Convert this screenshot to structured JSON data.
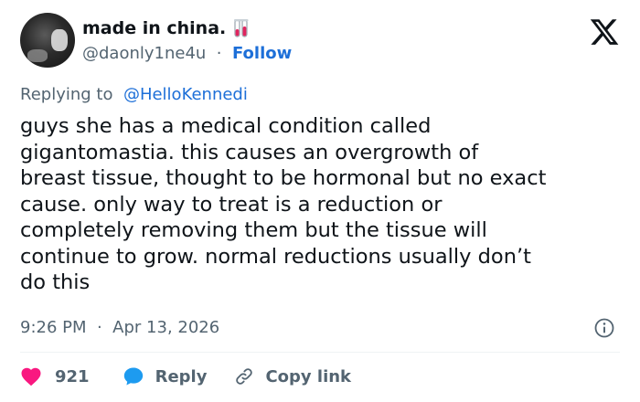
{
  "author": {
    "display_name": "made in china.",
    "name_emoji": "test-tube-emoji",
    "handle": "@daonly1ne4u",
    "separator": "·",
    "follow_label": "Follow",
    "avatar": "avatar-photo"
  },
  "header": {
    "logo_icon": "x-logo-icon"
  },
  "reply_context": {
    "prefix": "Replying to",
    "mention": "@HelloKennedi"
  },
  "tweet": {
    "lines": [
      "guys she has a medical condition called",
      "gigantomastia. this causes an overgrowth of",
      "breast tissue, thought to be hormonal but no exact",
      "cause. only way to treat is a reduction or",
      "completely removing them but the tissue will",
      "continue to grow. normal reductions usually don’t",
      "do this"
    ]
  },
  "meta": {
    "time": "9:26 PM",
    "separator": "·",
    "date": "Apr 13, 2026",
    "info_icon": "info-icon"
  },
  "actions": {
    "like_count": "921",
    "reply_label": "Reply",
    "copy_link_label": "Copy link"
  },
  "colors": {
    "text": "#0f1419",
    "secondary": "#536471",
    "link": "#1d6fd8",
    "like": "#f91880",
    "reply_icon": "#1d9bf0",
    "divider": "#eff3f4"
  }
}
